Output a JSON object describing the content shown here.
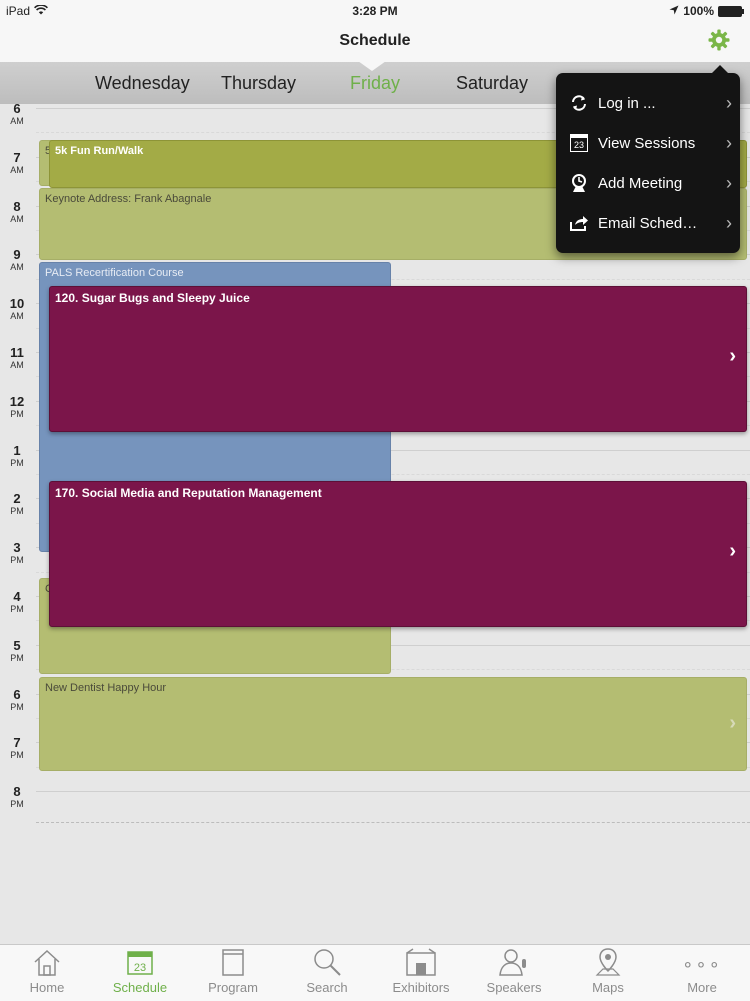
{
  "status_bar": {
    "device": "iPad",
    "time": "3:28 PM",
    "battery": "100%"
  },
  "nav": {
    "title": "Schedule"
  },
  "days": [
    "Wednesday",
    "Thursday",
    "Friday",
    "Saturday"
  ],
  "active_day": "Friday",
  "accent_color": "#6fb04a",
  "hours": [
    {
      "h": "6",
      "ap": "AM"
    },
    {
      "h": "7",
      "ap": "AM"
    },
    {
      "h": "8",
      "ap": "AM"
    },
    {
      "h": "9",
      "ap": "AM"
    },
    {
      "h": "10",
      "ap": "AM"
    },
    {
      "h": "11",
      "ap": "AM"
    },
    {
      "h": "12",
      "ap": "PM"
    },
    {
      "h": "1",
      "ap": "PM"
    },
    {
      "h": "2",
      "ap": "PM"
    },
    {
      "h": "3",
      "ap": "PM"
    },
    {
      "h": "4",
      "ap": "PM"
    },
    {
      "h": "5",
      "ap": "PM"
    },
    {
      "h": "6",
      "ap": "PM"
    },
    {
      "h": "7",
      "ap": "PM"
    },
    {
      "h": "8",
      "ap": "PM"
    }
  ],
  "events": {
    "fun_run": "5k Fun Run/Walk",
    "fun_run_behind": "5",
    "keynote": "Keynote Address: Frank Abagnale",
    "pals": "PALS Recertification Course",
    "sugar_bugs": "120. Sugar Bugs and Sleepy Juice",
    "social_media": "170. Social Media and Reputation Management",
    "hidden_c": "C",
    "happy_hour": "New Dentist Happy Hour"
  },
  "menu": {
    "items": [
      {
        "label": "Log in ...",
        "icon": "sync-icon"
      },
      {
        "label": "View Sessions",
        "icon": "calendar-icon",
        "icon_text": "23"
      },
      {
        "label": "Add Meeting",
        "icon": "meeting-icon"
      },
      {
        "label": "Email Sched…",
        "icon": "share-icon"
      }
    ]
  },
  "tabs": [
    {
      "label": "Home",
      "icon": "home-icon"
    },
    {
      "label": "Schedule",
      "icon": "calendar-icon",
      "icon_text": "23"
    },
    {
      "label": "Program",
      "icon": "book-icon"
    },
    {
      "label": "Search",
      "icon": "search-icon"
    },
    {
      "label": "Exhibitors",
      "icon": "booth-icon"
    },
    {
      "label": "Speakers",
      "icon": "speaker-icon"
    },
    {
      "label": "Maps",
      "icon": "map-pin-icon"
    },
    {
      "label": "More",
      "icon": "more-icon"
    }
  ],
  "active_tab": "Schedule"
}
